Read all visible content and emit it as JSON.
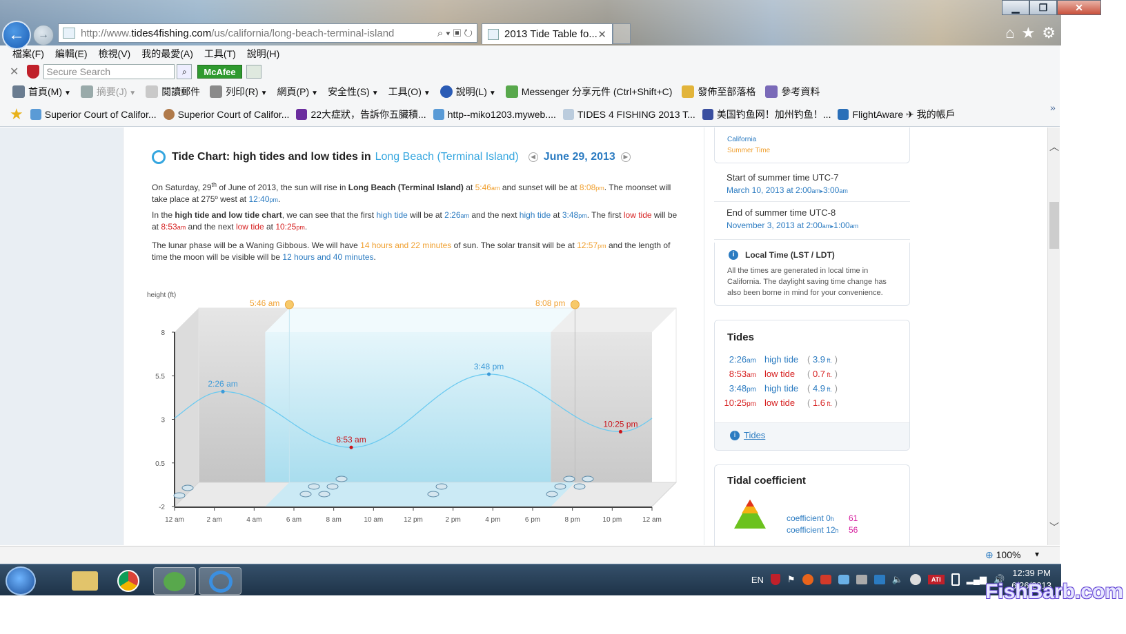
{
  "browser": {
    "window_buttons": {
      "minimize": "▁",
      "restore": "❐",
      "close": "✕"
    },
    "back_glyph": "←",
    "forward_glyph": "→",
    "url_prefix": "http://www.",
    "url_domain": "tides4fishing.com",
    "url_path": "/us/california/long-beach-terminal-island",
    "address_tools": "⌕ ▾ ▣ ↻",
    "tab_title": "2013 Tide Table fo...",
    "tab_close": "✕",
    "home_glyph": "⌂",
    "fav_glyph": "★",
    "tools_glyph": "⚙",
    "menu": [
      "檔案(F)",
      "編輯(E)",
      "檢視(V)",
      "我的最愛(A)",
      "工具(T)",
      "說明(H)"
    ],
    "toolbar_close": "✕",
    "search_placeholder": "Secure Search",
    "search_glyph": "⌕",
    "mcafee_label": "McAfee",
    "commands": {
      "home": "首頁(M)",
      "feeds": "摘要(J)",
      "read_mail": "閱讀郵件",
      "print": "列印(R)",
      "page": "網頁(P)",
      "safety": "安全性(S)",
      "tools": "工具(O)",
      "help": "說明(L)",
      "messenger": "Messenger 分享元件 (Ctrl+Shift+C)",
      "blog": "發佈至部落格",
      "reference": "參考資料"
    },
    "favorites": [
      "Superior Court of Califor...",
      "Superior Court of Califor...",
      "22大症狀，告訴你五臟積...",
      "http--miko1203.myweb....",
      "TIDES 4 FISHING 2013  T...",
      "美国钓鱼网！加州钓鱼！...",
      "FlightAware ✈ 我的帳戶"
    ],
    "favorites_more": "»",
    "zoom": "100%",
    "zoom_caret": "▾",
    "colors": {
      "link_blue": "#2b7bc1",
      "title_blue": "#35a6df",
      "low_red": "#d62020",
      "sun_orange": "#f0a030",
      "accent_green": "#2f9a2f"
    }
  },
  "page": {
    "title_prefix": "Tide Chart: high tides and low tides in",
    "location": "Long Beach (Terminal Island)",
    "date": "June 29, 2013",
    "p1": {
      "t1": "On Saturday, 29",
      "sup": "th",
      "t2": " of June of 2013, the sun will rise in ",
      "place": "Long Beach (Terminal Island)",
      "t3": " at ",
      "sunrise": "5:46",
      "am": "am",
      "t4": " and sunset will be at ",
      "sunset": "8:08",
      "pm": "pm",
      "t5": ". The moonset will take place at 275º west at ",
      "moonset": "12:40",
      "t6": "."
    },
    "p2": {
      "t1": "In the ",
      "bold": "high tide and low tide chart",
      "t2": ", we can see that the first ",
      "hl1": "high tide",
      "t3": " will be at ",
      "v1": "2:26",
      "t4": " and the next ",
      "hl2": "high tide",
      "t5": " at ",
      "v2": "3:48",
      "t6": ". The first ",
      "ll1": "low tide",
      "t7": " will be at ",
      "v3": "8:53",
      "t8": " and the next ",
      "ll2": "low tide",
      "t9": " at ",
      "v4": "10:25",
      "t10": "."
    },
    "p3": {
      "t1": "The lunar phase will be a Waning Gibbous. We will have ",
      "daylen": "14 hours and 22 minutes",
      "t2": " of sun. The solar transit will be at ",
      "transit": "12:57",
      "t3": " and the length of time the moon will be visible will be ",
      "moonvis": "12 hours and 40 minutes",
      "t4": "."
    }
  },
  "chart_data": {
    "type": "line",
    "ylabel": "height (ft)",
    "y_ticks": [
      "8",
      "5.5",
      "3",
      "0.5",
      "-2"
    ],
    "ylim": [
      -2,
      8
    ],
    "x_ticks": [
      "12 am",
      "2 am",
      "4 am",
      "6 am",
      "8 am",
      "10 am",
      "12 pm",
      "2 pm",
      "4 pm",
      "6 pm",
      "8 pm",
      "10 pm",
      "12 am"
    ],
    "xlim_hours": [
      0,
      24
    ],
    "sunrise_label": "5:46 am",
    "sunset_label": "8:08 pm",
    "sunrise_hour": 5.77,
    "sunset_hour": 20.13,
    "extremes": [
      {
        "hour": 2.43,
        "height": 3.9,
        "label": "2:26 am",
        "type": "high"
      },
      {
        "hour": 8.88,
        "height": 0.7,
        "label": "8:53 am",
        "type": "low"
      },
      {
        "hour": 15.8,
        "height": 4.9,
        "label": "3:48 pm",
        "type": "high"
      },
      {
        "hour": 22.42,
        "height": 1.6,
        "label": "10:25 pm",
        "type": "low"
      }
    ],
    "grid": false,
    "legend": "none"
  },
  "sidebar": {
    "region_label": "California",
    "summer_label": "Summer Time",
    "start_title": "Start of summer time UTC-7",
    "start_date": "March 10, 2013 at 2:00",
    "start_to": "3:00",
    "end_title": "End of summer time UTC-8",
    "end_date": "November 3, 2013 at 2:00",
    "end_to": "1:00",
    "am": "am",
    "arrow": "▸",
    "local_title": "Local Time (LST / LDT)",
    "local_text": "All the times are generated in local time in California. The daylight saving time change has also been borne in mind for your convenience.",
    "info_glyph": "i",
    "tides_title": "Tides",
    "tides": [
      {
        "time": "2:26",
        "ampm": "am",
        "type": "high tide",
        "height": "3.9",
        "unit": "ft."
      },
      {
        "time": "8:53",
        "ampm": "am",
        "type": "low tide",
        "height": "0.7",
        "unit": "ft."
      },
      {
        "time": "3:48",
        "ampm": "pm",
        "type": "high tide",
        "height": "4.9",
        "unit": "ft."
      },
      {
        "time": "10:25",
        "ampm": "pm",
        "type": "low tide",
        "height": "1.6",
        "unit": "ft."
      }
    ],
    "tides_link": "Tides",
    "coef_title": "Tidal coefficient",
    "coef_0_label": "coefficient 0",
    "coef_12_label": "coefficient 12",
    "coef_h": "h",
    "coef_0": "61",
    "coef_12": "56"
  },
  "taskbar": {
    "lang": "EN",
    "time": "12:39 PM",
    "date": "6/26/2013",
    "watermark": "FishBarb.com"
  }
}
